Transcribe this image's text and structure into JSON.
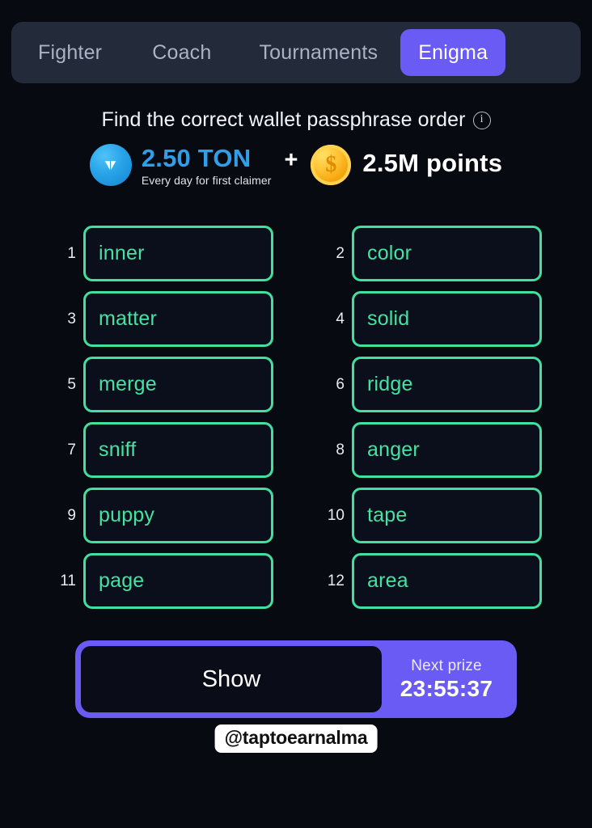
{
  "theme": {
    "page_bg": "#080a12",
    "tabbar_bg": "#232a39",
    "accent_purple": "#6a5bf5",
    "accent_green": "#3fe0a0",
    "ton_blue": "#2f9fe8",
    "coin_gold": "#ffc233"
  },
  "tabs": [
    {
      "label": "Fighter",
      "active": false
    },
    {
      "label": "Coach",
      "active": false
    },
    {
      "label": "Tournaments",
      "active": false
    },
    {
      "label": "Enigma",
      "active": true
    }
  ],
  "header": {
    "title": "Find the correct wallet passphrase order",
    "info_icon": "info-circle-icon",
    "info_glyph": "i"
  },
  "prize": {
    "ton_icon": "ton-coin-icon",
    "ton_amount": "2.50 TON",
    "ton_subtext": "Every day for first claimer",
    "separator": "+",
    "coin_icon": "dollar-coin-icon",
    "coin_glyph": "$",
    "points": "2.5M points"
  },
  "words": [
    {
      "num": "1",
      "word": "inner"
    },
    {
      "num": "2",
      "word": "color"
    },
    {
      "num": "3",
      "word": "matter"
    },
    {
      "num": "4",
      "word": "solid"
    },
    {
      "num": "5",
      "word": "merge"
    },
    {
      "num": "6",
      "word": "ridge"
    },
    {
      "num": "7",
      "word": "sniff"
    },
    {
      "num": "8",
      "word": "anger"
    },
    {
      "num": "9",
      "word": "puppy"
    },
    {
      "num": "10",
      "word": "tape"
    },
    {
      "num": "11",
      "word": "page"
    },
    {
      "num": "12",
      "word": "area"
    }
  ],
  "actions": {
    "show_label": "Show",
    "next_prize_label": "Next prize",
    "next_prize_time": "23:55:37"
  },
  "watermark": {
    "handle": "@taptoearnalma"
  }
}
